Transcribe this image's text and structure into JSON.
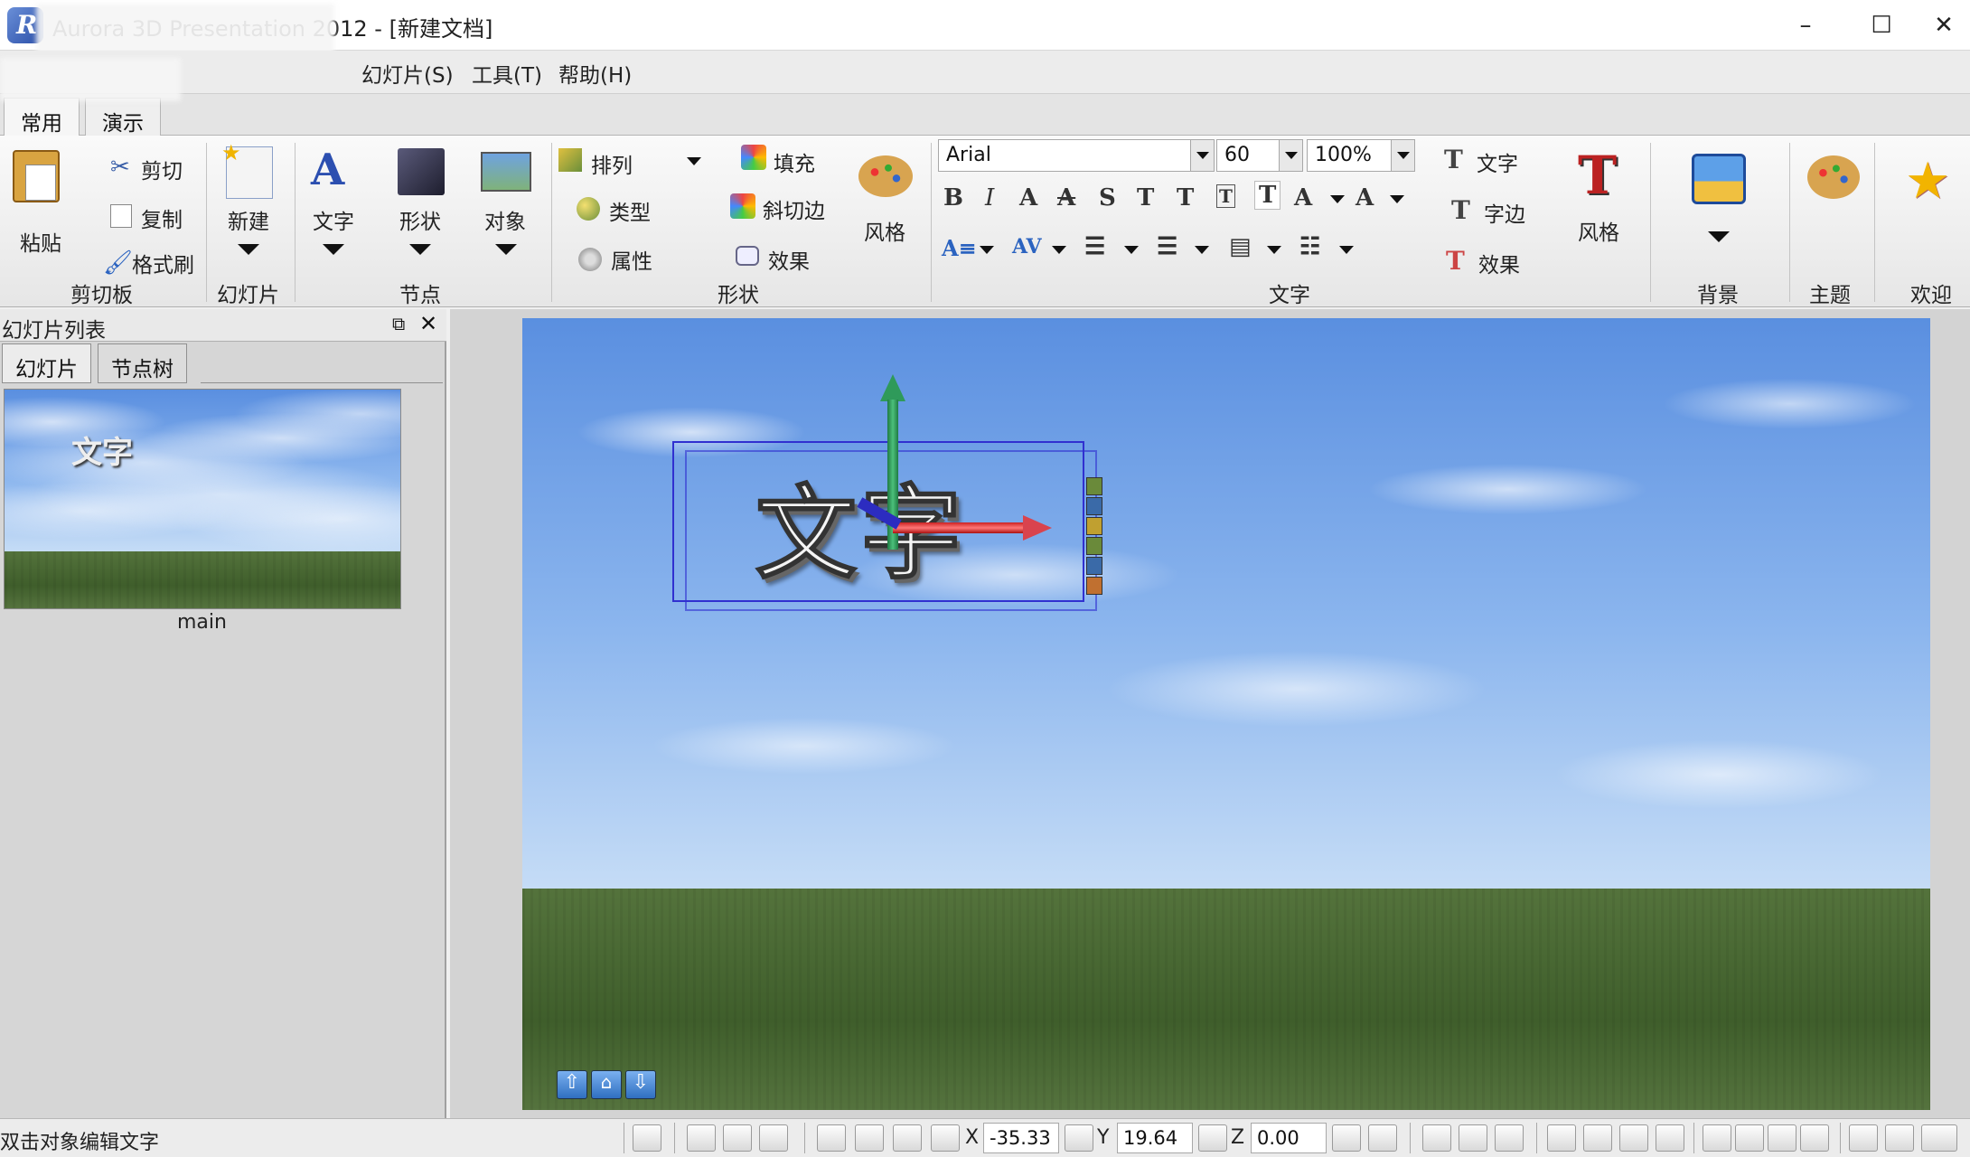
{
  "window": {
    "title": "Aurora 3D Presentation 2012 - [新建文档]",
    "minimize": "–",
    "maximize": "☐",
    "close": "✕"
  },
  "menu": {
    "items": [
      "幻灯片(S)",
      "工具(T)",
      "帮助(H)"
    ]
  },
  "ribbon_tabs": [
    "常用",
    "演示"
  ],
  "ribbon": {
    "clipboard": {
      "paste": "粘贴",
      "cut": "剪切",
      "copy": "复制",
      "format_painter": "格式刷",
      "group": "剪切板"
    },
    "slide": {
      "new": "新建",
      "group": "幻灯片"
    },
    "node": {
      "text": "文字",
      "shape": "形状",
      "object": "对象",
      "group": "节点"
    },
    "shape": {
      "arrange": "排列",
      "type": "类型",
      "attribute": "属性",
      "fill": "填充",
      "bevel": "斜切边",
      "effect": "效果",
      "style": "风格",
      "group": "形状"
    },
    "text": {
      "font": "Arial",
      "size": "60",
      "scale": "100%",
      "text_btn": "文字",
      "border_btn": "字边",
      "effect_btn": "效果",
      "style": "风格",
      "group": "文字"
    },
    "background": {
      "group": "背景"
    },
    "theme": {
      "group": "主题"
    },
    "welcome": {
      "group": "欢迎"
    }
  },
  "left_panel": {
    "title": "幻灯片列表",
    "tabs": [
      "幻灯片",
      "节点树"
    ],
    "slides": [
      {
        "name": "main",
        "thumb_text": "文字"
      }
    ]
  },
  "canvas": {
    "text": "文字"
  },
  "status": {
    "message": "双击对象编辑文字",
    "x_label": "X",
    "x_value": "-35.33",
    "y_label": "Y",
    "y_value": "19.64",
    "z_label": "Z",
    "z_value": "0.00"
  },
  "colors": {
    "sky": "#6f9fe6",
    "grass": "#4a6a34",
    "gizmo_x": "#d9434e",
    "gizmo_y": "#2f9a5a",
    "gizmo_z": "#2c2cc0",
    "selection": "#3030d0"
  }
}
